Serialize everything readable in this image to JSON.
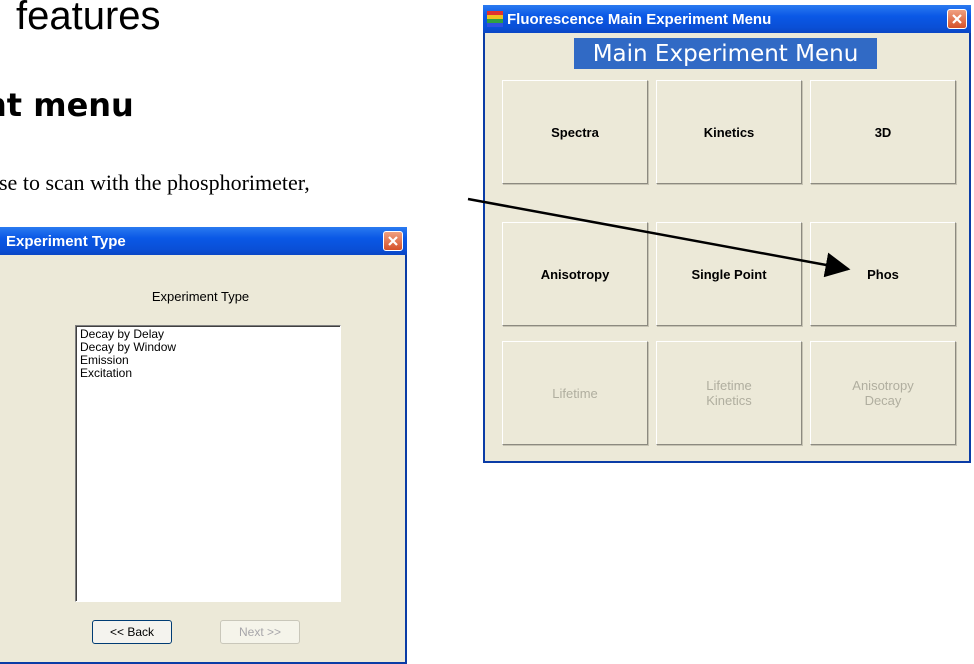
{
  "slide": {
    "title": "features",
    "subtitle": "nt menu",
    "body": "ose to scan with the phosphorimeter,"
  },
  "experiment_type_dialog": {
    "title": "Experiment Type",
    "heading": "Experiment Type",
    "items": [
      "Decay by Delay",
      "Decay by Window",
      "Emission",
      "Excitation"
    ],
    "back_label": "<< Back",
    "next_label": "Next >>",
    "next_enabled": false
  },
  "main_menu_window": {
    "title": "Fluorescence Main Experiment Menu",
    "banner": "Main Experiment Menu",
    "buttons": {
      "spectra": "Spectra",
      "kinetics": "Kinetics",
      "three_d": "3D",
      "anisotropy": "Anisotropy",
      "single_point": "Single Point",
      "phos": "Phos",
      "lifetime": "Lifetime",
      "lifetime_kinetics_1": "Lifetime",
      "lifetime_kinetics_2": "Kinetics",
      "anisotropy_decay_1": "Anisotropy",
      "anisotropy_decay_2": "Decay"
    },
    "disabled": [
      "Lifetime",
      "Lifetime Kinetics",
      "Anisotropy Decay"
    ]
  },
  "colors": {
    "titlebar": "#0a58e6",
    "window_bg": "#ece9d8",
    "banner_bg": "#316ac5",
    "close_button": "#d5512a"
  }
}
